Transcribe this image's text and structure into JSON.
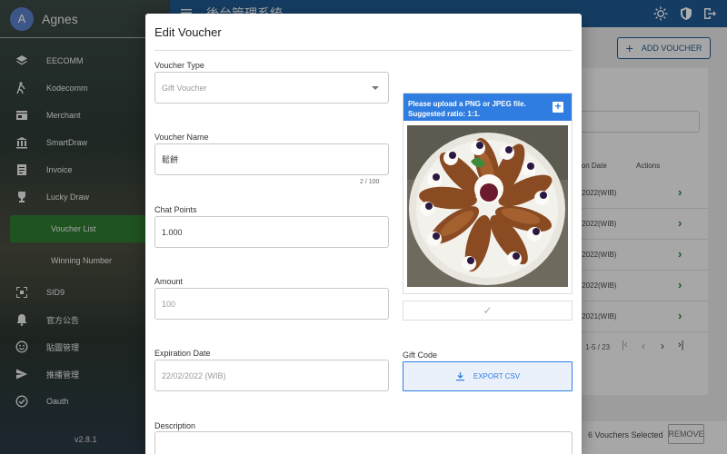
{
  "user": {
    "initial": "A",
    "name": "Agnes"
  },
  "sidebar": {
    "items": [
      {
        "label": "EECOMM",
        "icon": "layers-icon"
      },
      {
        "label": "Kodecomm",
        "icon": "person-walk-icon"
      },
      {
        "label": "Merchant",
        "icon": "store-icon"
      },
      {
        "label": "SmartDraw",
        "icon": "bank-icon"
      },
      {
        "label": "Invoice",
        "icon": "receipt-icon"
      },
      {
        "label": "Lucky Draw",
        "icon": "trophy-icon"
      },
      {
        "label": "Voucher List",
        "icon": ""
      },
      {
        "label": "Winning Number",
        "icon": ""
      },
      {
        "label": "SID9",
        "icon": "qr-icon"
      },
      {
        "label": "官方公告",
        "icon": "bell-icon"
      },
      {
        "label": "貼圖管理",
        "icon": "smiley-icon"
      },
      {
        "label": "推播管理",
        "icon": "send-icon"
      },
      {
        "label": "Oauth",
        "icon": "check-circle-icon"
      }
    ],
    "version": "v2.8.1"
  },
  "topbar": {
    "title": "後台管理系統"
  },
  "background": {
    "add_voucher_label": "ADD VOUCHER",
    "col_date": "ion Date",
    "col_actions": "Actions",
    "rows": [
      "/2022(WIB)",
      "/2022(WIB)",
      "/2022(WIB)",
      "/2022(WIB)",
      "/2021(WIB)"
    ],
    "pager": "1-5 / 23",
    "selected": "6 Vouchers Selected",
    "remove_label": "REMOVE"
  },
  "dialog": {
    "title": "Edit Voucher",
    "voucher_type_label": "Voucher Type",
    "voucher_type_value": "Gift Voucher",
    "voucher_name_label": "Voucher Name",
    "voucher_name_value": "鬆餅",
    "voucher_name_counter": "2 / 100",
    "chat_points_label": "Chat Points",
    "chat_points_value": "1.000",
    "amount_label": "Amount",
    "amount_value": "100",
    "expiration_label": "Expiration Date",
    "expiration_value": "22/02/2022 (WIB)",
    "description_label": "Description",
    "upload_text_1": "Please upload a PNG or JPEG file.",
    "upload_text_2": "Suggested ratio: 1:1.",
    "gift_code_label": "Gift Code",
    "export_label": "EXPORT CSV"
  },
  "colors": {
    "primary": "#1f5a92",
    "accent": "#2f7de1",
    "active": "#2e7d32"
  }
}
